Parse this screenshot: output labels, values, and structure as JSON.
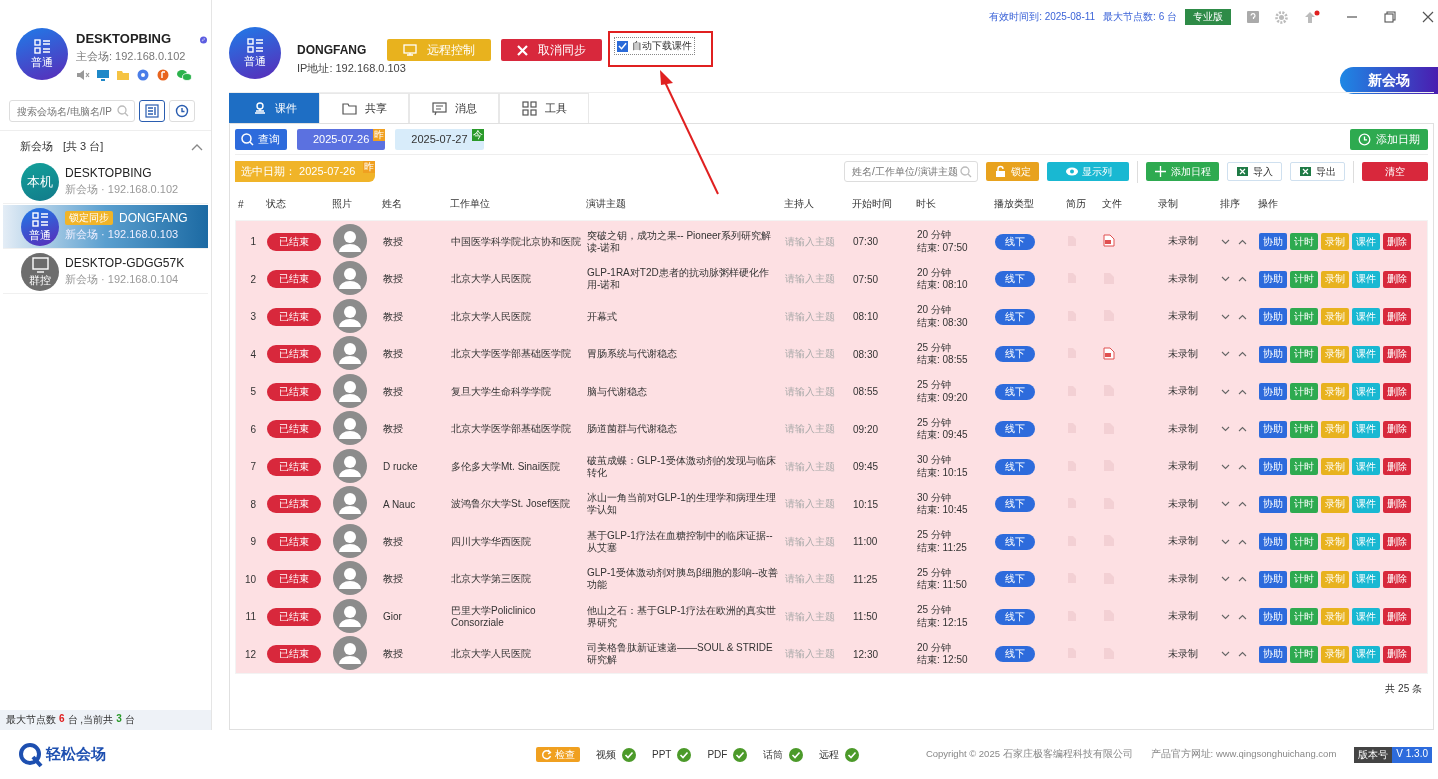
{
  "local": {
    "name": "DESKTOPBING",
    "avatar_label": "普通",
    "address": "主会场: 192.168.0.102"
  },
  "sidebar": {
    "search_placeholder": "搜索会场名/电脑名/IP",
    "group": {
      "name": "新会场",
      "count": "[共 3 台]",
      "expanded": true
    },
    "devices": [
      {
        "kind": "local",
        "avatar_label": "本机",
        "name": "DESKTOPBING",
        "detail": "新会场 · 192.168.0.102",
        "selected": false
      },
      {
        "kind": "normal",
        "avatar_label": "普通",
        "badge": "锁定同步",
        "name": "DONGFANG",
        "detail": "新会场 · 192.168.0.103",
        "selected": true
      },
      {
        "kind": "control",
        "avatar_label": "群控",
        "name": "DESKTOP-GDGG57K",
        "detail": "新会场 · 192.168.0.104",
        "selected": false
      }
    ],
    "summary": {
      "prefix": "最大节点数",
      "max": "6",
      "middle": "台 ,当前共",
      "current": "3",
      "suffix": "台"
    }
  },
  "device": {
    "name": "DONGFANG",
    "avatar_label": "普通",
    "ip": "IP地址: 192.168.0.103",
    "buttons": [
      {
        "kind": "remote",
        "label": "远程控制"
      },
      {
        "kind": "cancel",
        "label": "取消同步"
      }
    ],
    "auto_download": {
      "label": "自动下载课件",
      "checked": true
    }
  },
  "header": {
    "expiry": "有效时间到: 2025-08-11",
    "max_nodes": "最大节点数: 6 台",
    "edition": "专业版",
    "new_venue": "新会场"
  },
  "tabs": [
    {
      "kind": "courseware",
      "label": "课件",
      "selected": true
    },
    {
      "kind": "share",
      "label": "共享",
      "selected": false
    },
    {
      "kind": "message",
      "label": "消息",
      "selected": false
    },
    {
      "kind": "tools",
      "label": "工具",
      "selected": false
    }
  ],
  "toolbar": {
    "query": "查询",
    "dates": [
      {
        "date": "2025-07-26",
        "tag": "昨",
        "selected": true
      },
      {
        "date": "2025-07-27",
        "tag": "今",
        "selected": false
      }
    ],
    "add_date": "添加日期",
    "selected_date": {
      "label": "选中日期：",
      "date": "2025-07-26",
      "tag": "昨"
    },
    "search_placeholder": "姓名/工作单位/演讲主题",
    "buttons": [
      {
        "kind": "lock",
        "label": "锁定"
      },
      {
        "kind": "columns",
        "label": "显示列"
      },
      {
        "kind": "add",
        "label": "添加日程"
      },
      {
        "kind": "import",
        "label": "导入"
      },
      {
        "kind": "export",
        "label": "导出"
      },
      {
        "kind": "clear",
        "label": "清空"
      }
    ]
  },
  "table": {
    "columns": [
      "#",
      "状态",
      "照片",
      "姓名",
      "工作单位",
      "演讲主题",
      "主持人",
      "开始时间",
      "时长",
      "播放类型",
      "简历",
      "文件",
      "录制",
      "排序",
      "操作"
    ],
    "rows": [
      {
        "num": "1",
        "status": "已结束",
        "name": "教授",
        "org": "中国医学科学院北京协和医院",
        "topic": "突破之钥，成功之果-- Pioneer系列研究解读-诺和",
        "host": "请输入主题",
        "start": "07:30",
        "duration": "20 分钟",
        "end": "结束: 07:50",
        "play": "线下",
        "has_file": true,
        "record": "未录制",
        "actions": [
          "协助",
          "计时",
          "录制",
          "课件",
          "删除"
        ]
      },
      {
        "num": "2",
        "status": "已结束",
        "name": "教授",
        "org": "北京大学人民医院",
        "topic": "GLP-1RA对T2D患者的抗动脉粥样硬化作用-诺和",
        "host": "请输入主题",
        "start": "07:50",
        "duration": "20 分钟",
        "end": "结束: 08:10",
        "play": "线下",
        "has_file": false,
        "record": "未录制",
        "actions": [
          "协助",
          "计时",
          "录制",
          "课件",
          "删除"
        ]
      },
      {
        "num": "3",
        "status": "已结束",
        "name": "教授",
        "org": "北京大学人民医院",
        "topic": "开幕式",
        "host": "请输入主题",
        "start": "08:10",
        "duration": "20 分钟",
        "end": "结束: 08:30",
        "play": "线下",
        "has_file": false,
        "record": "未录制",
        "actions": [
          "协助",
          "计时",
          "录制",
          "课件",
          "删除"
        ]
      },
      {
        "num": "4",
        "status": "已结束",
        "name": "教授",
        "org": "北京大学医学部基础医学院",
        "topic": "胃肠系统与代谢稳态",
        "host": "请输入主题",
        "start": "08:30",
        "duration": "25 分钟",
        "end": "结束: 08:55",
        "play": "线下",
        "has_file": true,
        "record": "未录制",
        "actions": [
          "协助",
          "计时",
          "录制",
          "课件",
          "删除"
        ]
      },
      {
        "num": "5",
        "status": "已结束",
        "name": "教授",
        "org": "复旦大学生命科学学院",
        "topic": "脑与代谢稳态",
        "host": "请输入主题",
        "start": "08:55",
        "duration": "25 分钟",
        "end": "结束: 09:20",
        "play": "线下",
        "has_file": false,
        "record": "未录制",
        "actions": [
          "协助",
          "计时",
          "录制",
          "课件",
          "删除"
        ]
      },
      {
        "num": "6",
        "status": "已结束",
        "name": "教授",
        "org": "北京大学医学部基础医学院",
        "topic": "肠道菌群与代谢稳态",
        "host": "请输入主题",
        "start": "09:20",
        "duration": "25 分钟",
        "end": "结束: 09:45",
        "play": "线下",
        "has_file": false,
        "record": "未录制",
        "actions": [
          "协助",
          "计时",
          "录制",
          "课件",
          "删除"
        ]
      },
      {
        "num": "7",
        "status": "已结束",
        "name": "D rucke",
        "org": "多伦多大学Mt. Sinai医院",
        "topic": "破茧成蝶：GLP-1受体激动剂的发现与临床转化",
        "host": "请输入主题",
        "start": "09:45",
        "duration": "30 分钟",
        "end": "结束: 10:15",
        "play": "线下",
        "has_file": false,
        "record": "未录制",
        "actions": [
          "协助",
          "计时",
          "录制",
          "课件",
          "删除"
        ]
      },
      {
        "num": "8",
        "status": "已结束",
        "name": "A Nauc",
        "org": "波鸿鲁尔大学St. Josef医院",
        "topic": "冰山一角当前对GLP-1的生理学和病理生理学认知",
        "host": "请输入主题",
        "start": "10:15",
        "duration": "30 分钟",
        "end": "结束: 10:45",
        "play": "线下",
        "has_file": false,
        "record": "未录制",
        "actions": [
          "协助",
          "计时",
          "录制",
          "课件",
          "删除"
        ]
      },
      {
        "num": "9",
        "status": "已结束",
        "name": "教授",
        "org": "四川大学华西医院",
        "topic": "基于GLP-1疗法在血糖控制中的临床证据--从艾塞",
        "host": "请输入主题",
        "start": "11:00",
        "duration": "25 分钟",
        "end": "结束: 11:25",
        "play": "线下",
        "has_file": false,
        "record": "未录制",
        "actions": [
          "协助",
          "计时",
          "录制",
          "课件",
          "删除"
        ]
      },
      {
        "num": "10",
        "status": "已结束",
        "name": "教授",
        "org": "北京大学第三医院",
        "topic": "GLP-1受体激动剂对胰岛β细胞的影响--改善功能",
        "host": "请输入主题",
        "start": "11:25",
        "duration": "25 分钟",
        "end": "结束: 11:50",
        "play": "线下",
        "has_file": false,
        "record": "未录制",
        "actions": [
          "协助",
          "计时",
          "录制",
          "课件",
          "删除"
        ]
      },
      {
        "num": "11",
        "status": "已结束",
        "name": "Gior",
        "org": "巴里大学Policlinico Consorziale",
        "topic": "他山之石：基于GLP-1疗法在欧洲的真实世界研究",
        "host": "请输入主题",
        "start": "11:50",
        "duration": "25 分钟",
        "end": "结束: 12:15",
        "play": "线下",
        "has_file": false,
        "record": "未录制",
        "actions": [
          "协助",
          "计时",
          "录制",
          "课件",
          "删除"
        ]
      },
      {
        "num": "12",
        "status": "已结束",
        "name": "教授",
        "org": "北京大学人民医院",
        "topic": "司美格鲁肽新证速递——SOUL & STRIDE研究解",
        "host": "请输入主题",
        "start": "12:30",
        "duration": "20 分钟",
        "end": "结束: 12:50",
        "play": "线下",
        "has_file": false,
        "record": "未录制",
        "actions": [
          "协助",
          "计时",
          "录制",
          "课件",
          "删除"
        ]
      }
    ],
    "total": "共 25 条"
  },
  "footer": {
    "logo": "轻松会场",
    "check": "检查",
    "checks": [
      {
        "label": "视频",
        "ok": true
      },
      {
        "label": "PPT",
        "ok": true
      },
      {
        "label": "PDF",
        "ok": true
      },
      {
        "label": "话筒",
        "ok": true
      },
      {
        "label": "远程",
        "ok": true
      }
    ],
    "copyright": "Copyright © 2025 石家庄极客编程科技有限公司",
    "website": "产品官方网址: www.qingsonghuichang.com",
    "version_label": "版本号",
    "version": "V 1.3.0"
  }
}
